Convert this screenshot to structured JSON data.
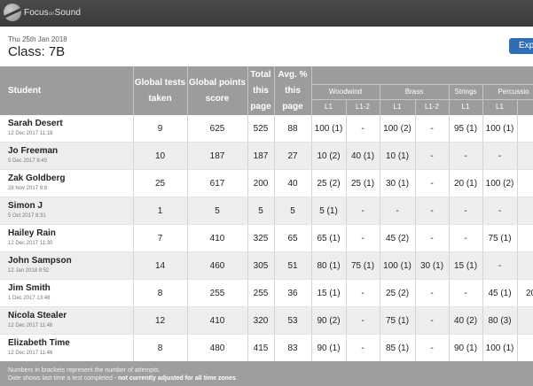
{
  "app": {
    "brand": "Focus",
    "brand_small": "on",
    "brand_end": "Sound"
  },
  "header": {
    "date": "Thu 25th Jan 2018",
    "class_title": "Class: 7B",
    "export_label": "Exp"
  },
  "table": {
    "headers": {
      "student": "Student",
      "global_tests": "Global tests taken",
      "global_points": "Global points score",
      "total": "Total this page",
      "avg": "Avg. % this page"
    },
    "groups": [
      "Woodwind",
      "Brass",
      "Strings",
      "Percussio"
    ],
    "levels": [
      "L1",
      "L1-2",
      "L1",
      "L1-2",
      "L1",
      "L1",
      ""
    ],
    "rows": [
      {
        "name": "Sarah Desert",
        "date": "12 Dec 2017 11:18",
        "tests": "9",
        "points": "625",
        "total": "525",
        "avg": "88",
        "cells": [
          "100 (1)",
          "-",
          "100 (2)",
          "-",
          "95 (1)",
          "100 (1)",
          ""
        ]
      },
      {
        "name": "Jo Freeman",
        "date": "5 Dec 2017 9:45",
        "tests": "10",
        "points": "187",
        "total": "187",
        "avg": "27",
        "cells": [
          "10 (2)",
          "40 (1)",
          "10 (1)",
          "-",
          "-",
          "-",
          ""
        ]
      },
      {
        "name": "Zak Goldberg",
        "date": "28 Nov 2017 9:8",
        "tests": "25",
        "points": "617",
        "total": "200",
        "avg": "40",
        "cells": [
          "25 (2)",
          "25 (1)",
          "30 (1)",
          "-",
          "20 (1)",
          "100 (2)",
          ""
        ]
      },
      {
        "name": "Simon J",
        "date": "5 Oct 2017 8:31",
        "tests": "1",
        "points": "5",
        "total": "5",
        "avg": "5",
        "cells": [
          "5 (1)",
          "-",
          "-",
          "-",
          "-",
          "-",
          ""
        ]
      },
      {
        "name": "Hailey Rain",
        "date": "12 Dec 2017 11:30",
        "tests": "7",
        "points": "410",
        "total": "325",
        "avg": "65",
        "cells": [
          "65 (1)",
          "-",
          "45 (2)",
          "-",
          "-",
          "75 (1)",
          ""
        ]
      },
      {
        "name": "John Sampson",
        "date": "12 Jan 2018 8:52",
        "tests": "14",
        "points": "460",
        "total": "305",
        "avg": "51",
        "cells": [
          "80 (1)",
          "75 (1)",
          "100 (1)",
          "30 (1)",
          "15 (1)",
          "-",
          ""
        ]
      },
      {
        "name": "Jim Smith",
        "date": "1 Dec 2017 13:48",
        "tests": "8",
        "points": "255",
        "total": "255",
        "avg": "36",
        "cells": [
          "15 (1)",
          "-",
          "25 (2)",
          "-",
          "-",
          "45 (1)",
          "20"
        ]
      },
      {
        "name": "Nicola Stealer",
        "date": "12 Dec 2017 11:46",
        "tests": "12",
        "points": "410",
        "total": "320",
        "avg": "53",
        "cells": [
          "90 (2)",
          "-",
          "75 (1)",
          "-",
          "40 (2)",
          "80 (3)",
          ""
        ]
      },
      {
        "name": "Elizabeth Time",
        "date": "12 Dec 2017 11:46",
        "tests": "8",
        "points": "480",
        "total": "415",
        "avg": "83",
        "cells": [
          "90 (1)",
          "-",
          "85 (1)",
          "-",
          "90 (1)",
          "100 (1)",
          ""
        ]
      }
    ]
  },
  "footer": {
    "line1": "Numbers in brackets represent the number of attempts.",
    "line2": "Date shows last time a test completed - ",
    "line2_warn": "not currently adjusted for all time zones",
    "line2_end": "."
  }
}
